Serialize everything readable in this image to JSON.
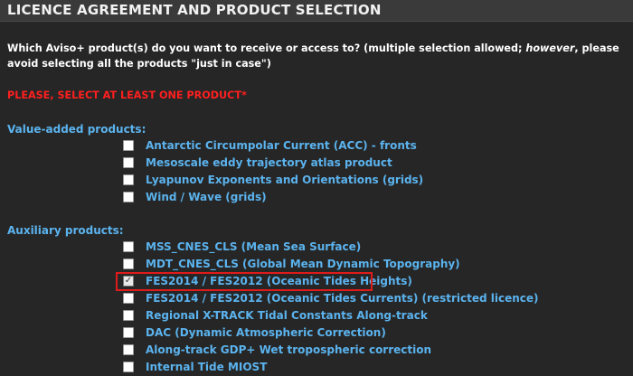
{
  "page": {
    "title": "LICENCE AGREEMENT AND PRODUCT SELECTION",
    "question_part1": "Which Aviso+ product(s) do you want to receive or access to? (multiple selection allowed; ",
    "question_emphasis": "however",
    "question_part2": ", please avoid selecting all the products \"just in case\")",
    "warning": "PLEASE, SELECT AT LEAST ONE PRODUCT*"
  },
  "colors": {
    "background": "#262626",
    "link_blue": "#5bb3ee",
    "warning_red": "#ff1f1f",
    "highlight_red": "#e01b1b"
  },
  "value_added": {
    "heading": "Value-added products:",
    "items": [
      {
        "label": "Antarctic Circumpolar Current (ACC) - fronts",
        "checked": false
      },
      {
        "label": "Mesoscale eddy trajectory atlas product",
        "checked": false
      },
      {
        "label": "Lyapunov Exponents and Orientations (grids)",
        "checked": false
      },
      {
        "label": "Wind / Wave (grids)",
        "checked": false
      }
    ]
  },
  "auxiliary": {
    "heading": "Auxiliary products:",
    "items": [
      {
        "label": "MSS_CNES_CLS (Mean Sea Surface)",
        "checked": false
      },
      {
        "label": "MDT_CNES_CLS (Global Mean Dynamic Topography)",
        "checked": false
      },
      {
        "label": "FES2014 / FES2012 (Oceanic Tides Heights)",
        "checked": true
      },
      {
        "label": "FES2014 / FES2012 (Oceanic Tides Currents) (restricted licence)",
        "checked": false
      },
      {
        "label": "Regional X-TRACK Tidal Constants Along-track",
        "checked": false
      },
      {
        "label": "DAC (Dynamic Atmospheric Correction)",
        "checked": false
      },
      {
        "label": "Along-track GDP+ Wet tropospheric correction",
        "checked": false
      },
      {
        "label": "Internal Tide MIOST",
        "checked": false
      }
    ]
  }
}
